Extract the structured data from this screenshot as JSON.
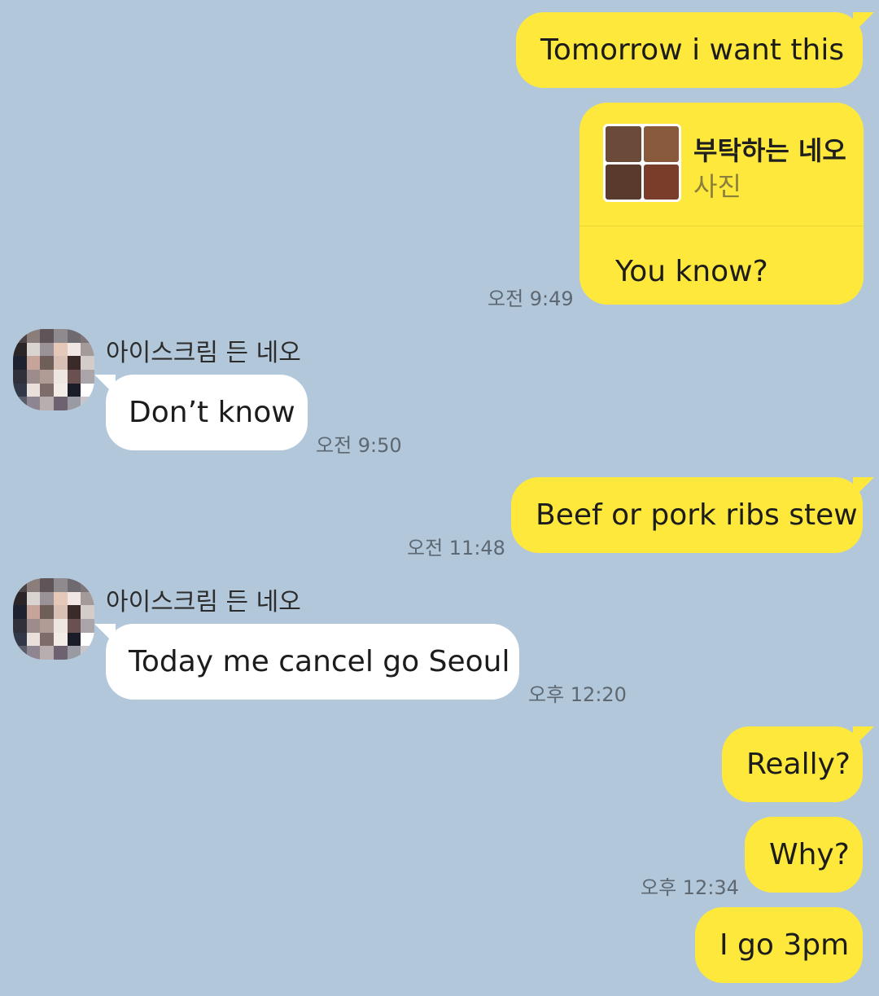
{
  "colors": {
    "background": "#b2c7da",
    "outgoing": "#fee83c",
    "incoming": "#ffffff"
  },
  "messages": [
    {
      "text": "Tomorrow  i want this"
    },
    {
      "card": {
        "title": "부탁하는 네오",
        "subtitle": "사진",
        "thumbnail_icon": "food-photo-collage"
      },
      "text": "You know?",
      "time": "오전 9:49"
    },
    {
      "sender": "아이스크림 든 네오",
      "text": "Don’t know",
      "time": "오전 9:50"
    },
    {
      "text": "Beef or pork ribs stew",
      "time": "오전 11:48"
    },
    {
      "sender": "아이스크림 든 네오",
      "text": "Today me cancel go Seoul",
      "time": "오후 12:20"
    },
    {
      "text": "Really?"
    },
    {
      "text": "Why?",
      "time": "오후 12:34"
    },
    {
      "text": "I go 3pm"
    }
  ]
}
